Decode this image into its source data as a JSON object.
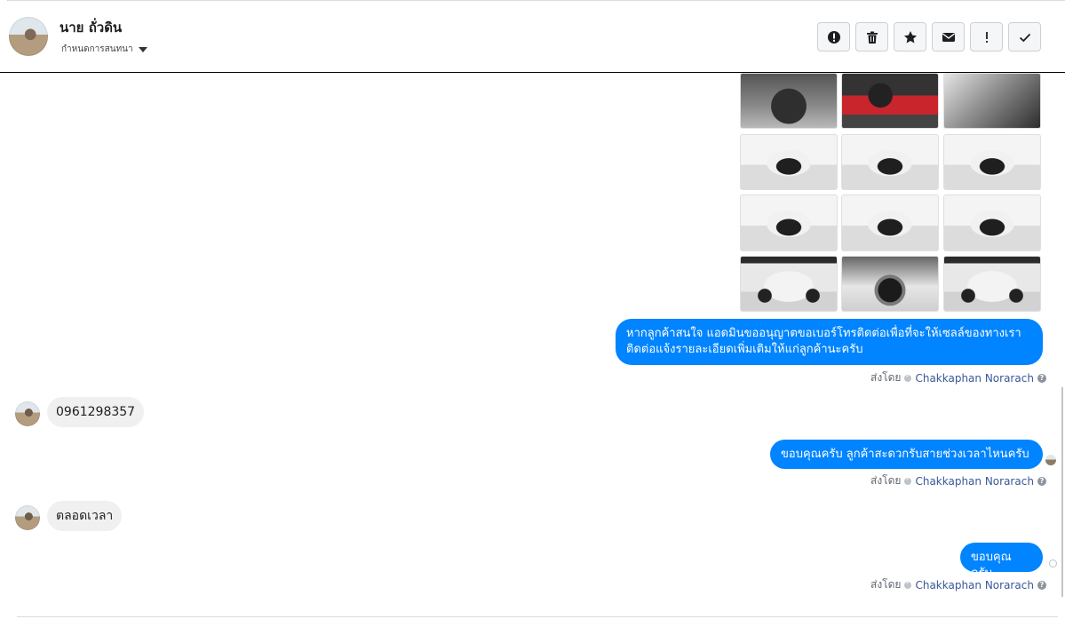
{
  "header": {
    "name": "นาย ถั่วดิน",
    "assign_label": "กำหนดการสนทนา",
    "actions": [
      {
        "icon": "alert-circle-icon",
        "label": "ทำเครื่องหมายเป็นสแปม"
      },
      {
        "icon": "trash-icon",
        "label": "ลบ"
      },
      {
        "icon": "star-icon",
        "label": "ติดดาว"
      },
      {
        "icon": "envelope-icon",
        "label": "ทำเครื่องหมายว่ายังไม่ได้อ่าน"
      },
      {
        "icon": "exclamation-icon",
        "label": "ติดตามผล"
      },
      {
        "icon": "check-icon",
        "label": "เสร็จสิ้น"
      }
    ]
  },
  "messages": {
    "out_1": "หากลูกค้าสนใจ แอดมินขออนุญาตขอเบอร์โทรติดต่อเพื่อที่จะให้เซลล์ของทางเราติดต่อแจ้งรายละเอียดเพิ่มเติมให้แก่ลูกค้านะครับ",
    "in_1": "0961298357",
    "out_2": "ขอบคุณครับ ลูกค้าสะดวกรับสายช่วงเวลาไหนครับ",
    "in_2": "ตลอดเวลา",
    "out_3": "ขอบคุณครับ"
  },
  "sent_by": {
    "prefix": "ส่งโดย",
    "agent": "Chakkaphan Norarach",
    "help": "?"
  }
}
